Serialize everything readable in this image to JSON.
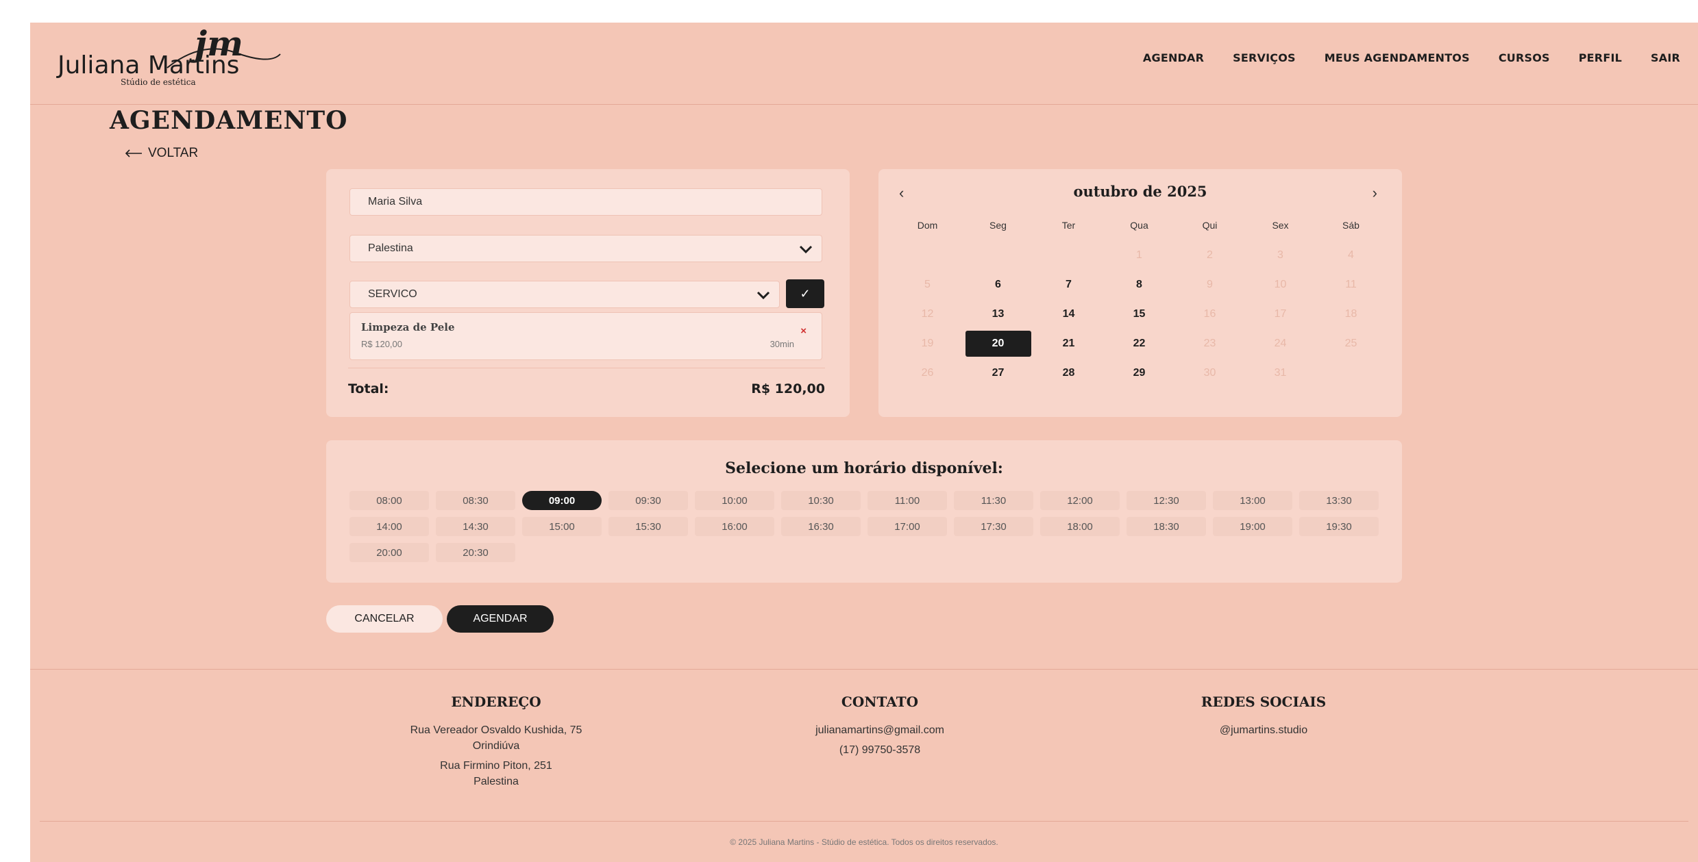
{
  "header": {
    "logo_mono": "jm",
    "logo_name": "Juliana Martins",
    "logo_sub": "Stúdio de estética",
    "nav": [
      "AGENDAR",
      "SERVIÇOS",
      "MEUS AGENDAMENTOS",
      "CURSOS",
      "PERFIL",
      "SAIR"
    ]
  },
  "page": {
    "title": "AGENDAMENTO",
    "back_label": "VOLTAR"
  },
  "form": {
    "name_value": "Maria Silva",
    "location_value": "Palestina",
    "service_select_value": "SERVICO",
    "add_button": "✓",
    "selected_service": {
      "name": "Limpeza de Pele",
      "price": "R$ 120,00",
      "duration": "30min",
      "remove": "×"
    },
    "total_label": "Total:",
    "total_value": "R$ 120,00"
  },
  "calendar": {
    "month_label": "outubro de 2025",
    "prev": "‹",
    "next": "›",
    "weekdays": [
      "Dom",
      "Seg",
      "Ter",
      "Qua",
      "Qui",
      "Sex",
      "Sáb"
    ],
    "leading_blanks": 3,
    "days": 31,
    "selected_day": 20,
    "enabled_days": [
      6,
      7,
      8,
      13,
      14,
      15,
      20,
      21,
      22,
      27,
      28,
      29
    ]
  },
  "slots": {
    "title": "Selecione um horário disponível:",
    "times": [
      "08:00",
      "08:30",
      "09:00",
      "09:30",
      "10:00",
      "10:30",
      "11:00",
      "11:30",
      "12:00",
      "12:30",
      "13:00",
      "13:30",
      "14:00",
      "14:30",
      "15:00",
      "15:30",
      "16:00",
      "16:30",
      "17:00",
      "17:30",
      "18:00",
      "18:30",
      "19:00",
      "19:30",
      "20:00",
      "20:30"
    ],
    "selected": "09:00"
  },
  "actions": {
    "cancel": "CANCELAR",
    "submit": "AGENDAR"
  },
  "footer": {
    "address_title": "ENDEREÇO",
    "address_1_street": "Rua Vereador Osvaldo Kushida, 75",
    "address_1_city": "Orindiúva",
    "address_2_street": "Rua Firmino Piton, 251",
    "address_2_city": "Palestina",
    "contact_title": "CONTATO",
    "email": "julianamartins@gmail.com",
    "phone": "(17) 99750-3578",
    "social_title": "REDES SOCIAIS",
    "instagram": "@jumartins.studio",
    "copyright": "© 2025 Juliana Martins - Stúdio de estética. Todos os direitos reservados."
  },
  "colors": {
    "background": "#f4c6b6",
    "card": "#f8d6cb",
    "input": "#fbe7e1",
    "accent_dark": "#1e1e1e",
    "remove_red": "#d03030"
  }
}
